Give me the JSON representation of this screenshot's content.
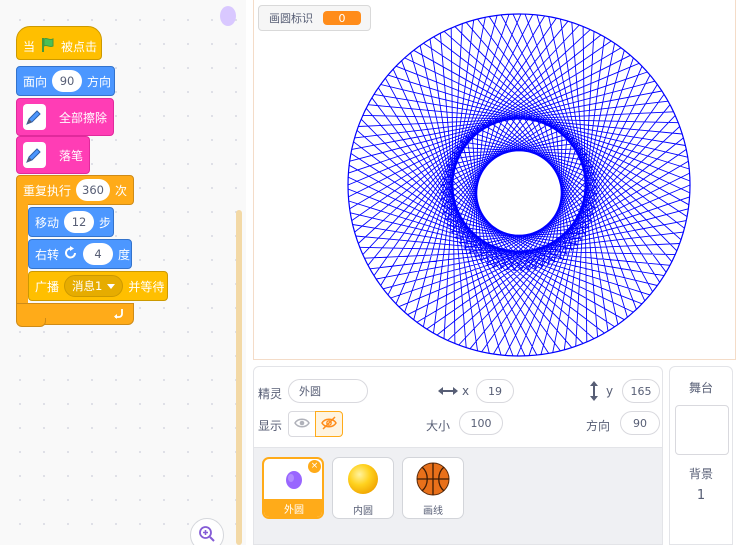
{
  "colors": {
    "event": "#ffbf00",
    "motion": "#4c97ff",
    "pen": "#ff3db5",
    "control": "#ffab19",
    "pen_drawing": "#0000ff",
    "accent": "#ff8c1a"
  },
  "code": {
    "when_flag": {
      "prefix": "当",
      "icon": "green-flag-icon",
      "suffix": "被点击"
    },
    "point_direction": {
      "prefix": "面向",
      "value": "90",
      "suffix": "方向"
    },
    "erase_all": {
      "icon": "pen-extension-icon",
      "label": "全部擦除"
    },
    "pen_down": {
      "icon": "pen-extension-icon",
      "label": "落笔"
    },
    "repeat": {
      "prefix": "重复执行",
      "value": "360",
      "suffix": "次"
    },
    "move": {
      "prefix": "移动",
      "value": "12",
      "suffix": "步"
    },
    "turn": {
      "prefix": "右转",
      "icon": "rotate-right-icon",
      "value": "4",
      "suffix": "度"
    },
    "broadcast": {
      "prefix": "广播",
      "message": "消息1",
      "suffix": "并等待"
    },
    "loop_icon": "loop-arrow-icon",
    "zoom_icon": "zoom-in-icon"
  },
  "stage": {
    "monitor": {
      "label": "画圆标识",
      "value": "0"
    }
  },
  "sprite_info": {
    "sprite_label": "精灵",
    "sprite_name": "外圆",
    "x_label": "x",
    "x_value": "19",
    "y_label": "y",
    "y_value": "165",
    "show_label": "显示",
    "size_label": "大小",
    "size_value": "100",
    "direction_label": "方向",
    "direction_value": "90",
    "show_icon": "eye-icon",
    "hide_icon": "eye-slash-icon"
  },
  "sprites": [
    {
      "name": "外圆",
      "thumb": "purple-dot",
      "selected": true
    },
    {
      "name": "内圆",
      "thumb": "yellow-ball",
      "selected": false
    },
    {
      "name": "画线",
      "thumb": "basketball",
      "selected": false
    }
  ],
  "stage_target": {
    "title": "舞台",
    "backdrop_label": "背景",
    "backdrop_count": "1"
  }
}
